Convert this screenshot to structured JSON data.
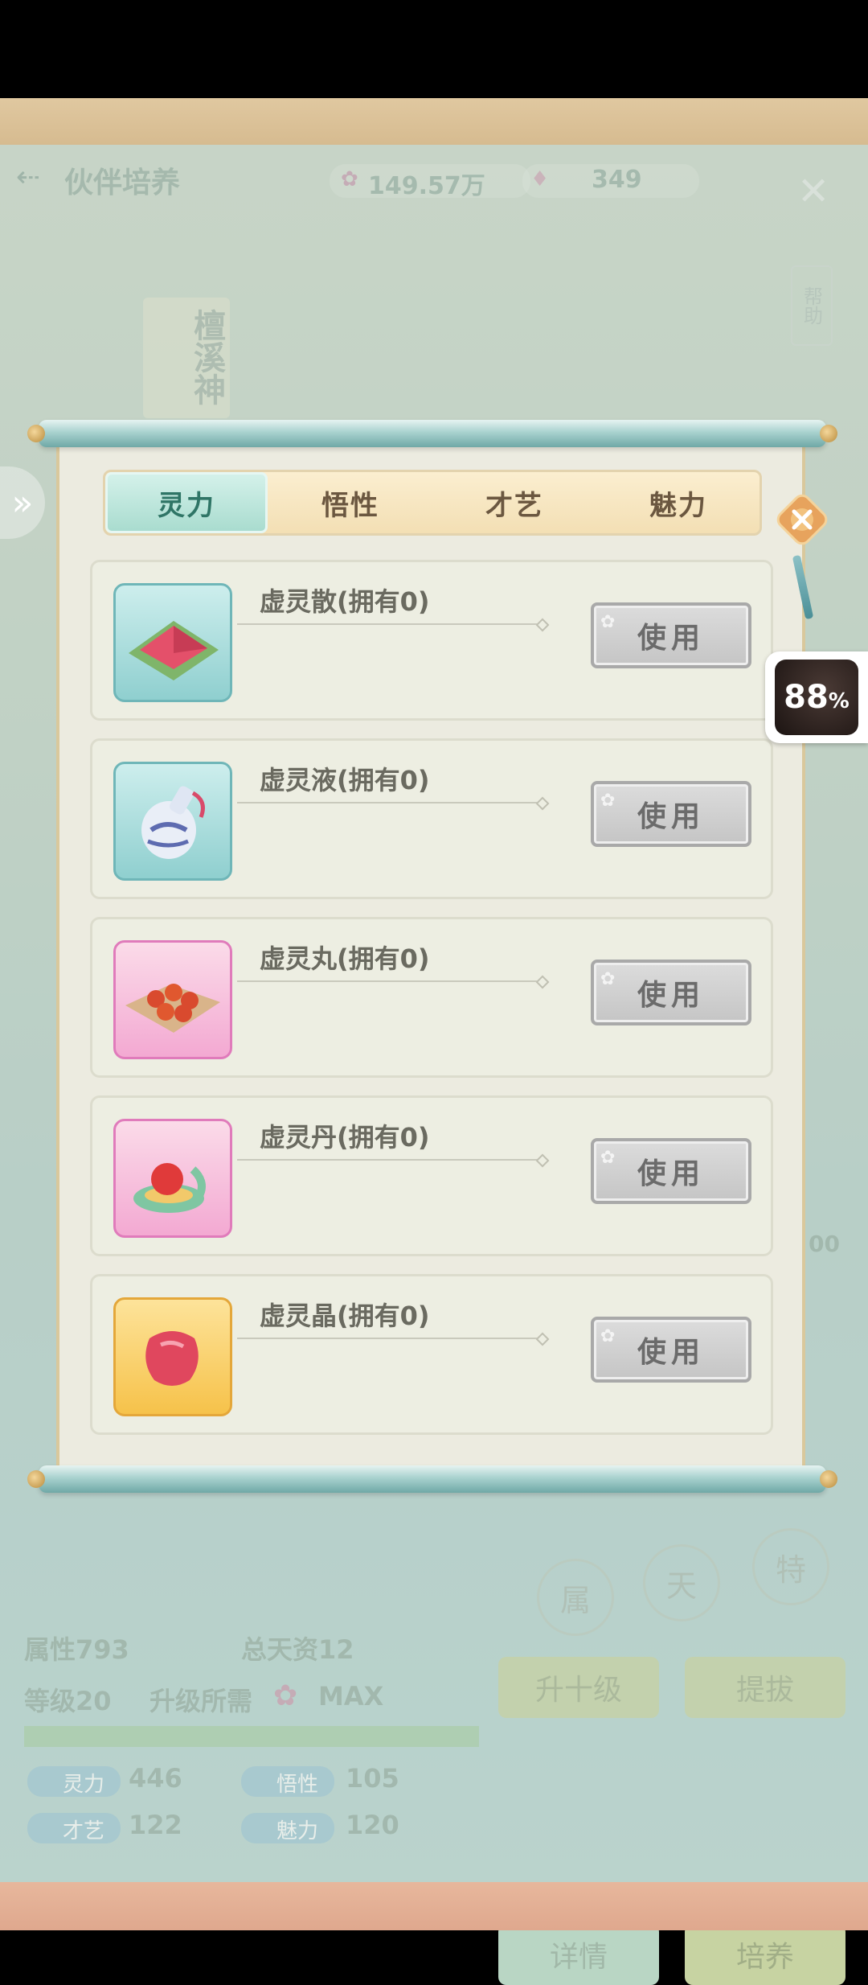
{
  "background": {
    "title": "伙伴培养",
    "currency_amount": "149.57万",
    "gem_amount": "349",
    "help_label": "帮助",
    "character_name": "檀溪神",
    "attr_total": "属性793",
    "talent_total": "总天资12",
    "level": "等级20",
    "upgrade_needs_label": "升级所需",
    "upgrade_needs_value": "MAX",
    "stats": [
      {
        "label": "灵力",
        "value": "446"
      },
      {
        "label": "悟性",
        "value": "105"
      },
      {
        "label": "才艺",
        "value": "122"
      },
      {
        "label": "魅力",
        "value": "120"
      }
    ],
    "round_buttons": [
      "属",
      "天",
      "特"
    ],
    "action_buttons": [
      "升十级",
      "提拔",
      "详情",
      "培养"
    ],
    "side_right_value": "00"
  },
  "tabs": [
    {
      "label": "灵力",
      "active": true
    },
    {
      "label": "悟性",
      "active": false
    },
    {
      "label": "才艺",
      "active": false
    },
    {
      "label": "魅力",
      "active": false
    }
  ],
  "items": [
    {
      "name": "虚灵散(拥有0)",
      "icon": "powder-packet-icon",
      "frame": "teal",
      "use_label": "使用"
    },
    {
      "name": "虚灵液(拥有0)",
      "icon": "vase-icon",
      "frame": "teal",
      "use_label": "使用"
    },
    {
      "name": "虚灵丸(拥有0)",
      "icon": "pills-icon",
      "frame": "pink",
      "use_label": "使用"
    },
    {
      "name": "虚灵丹(拥有0)",
      "icon": "elixir-box-icon",
      "frame": "pink",
      "use_label": "使用"
    },
    {
      "name": "虚灵晶(拥有0)",
      "icon": "red-crystal-icon",
      "frame": "gold",
      "use_label": "使用"
    }
  ],
  "badge": {
    "value": "88",
    "unit": "%"
  },
  "colors": {
    "teal_frame": "#9bd4d1",
    "pink_frame": "#f3a9d2",
    "gold_frame": "#f6cc58",
    "active_tab": "#a9dccf"
  }
}
